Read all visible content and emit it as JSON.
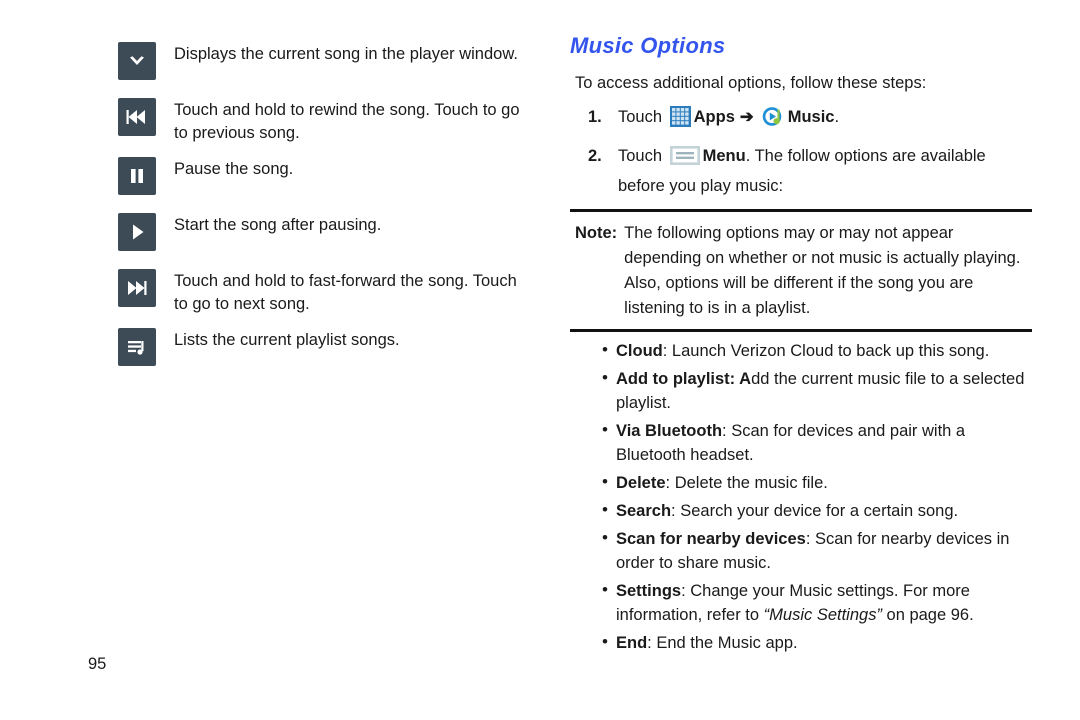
{
  "page_number": "95",
  "left_column": {
    "items": [
      {
        "icon": "chevron-down-icon",
        "text": "Displays the current song in the player window."
      },
      {
        "icon": "rewind-icon",
        "text": "Touch and hold to rewind the song. Touch to go to previous song."
      },
      {
        "icon": "pause-icon",
        "text": "Pause the song."
      },
      {
        "icon": "play-icon",
        "text": "Start the song after pausing."
      },
      {
        "icon": "fast-forward-icon",
        "text": "Touch and hold to fast-forward the song. Touch to go to next song."
      },
      {
        "icon": "playlist-icon",
        "text": "Lists the current playlist songs."
      }
    ]
  },
  "right_column": {
    "heading": "Music Options",
    "heading_color": "#3355ee",
    "intro": "To access additional options, follow these steps:",
    "steps": [
      {
        "number": "1.",
        "pre_icon_text": "Touch ",
        "icon1": "apps-grid-icon",
        "label1": "Apps",
        "arrow": "➔",
        "icon2": "music-app-icon",
        "label2": "Music",
        "post_text": "."
      },
      {
        "number": "2.",
        "pre_icon_text": "Touch ",
        "icon1": "menu-icon",
        "label1": "Menu",
        "post_text": ". The follow options are available before you play music:"
      }
    ],
    "note": {
      "label": "Note:",
      "body": "The following options may or may not appear depending on whether or not music is actually playing. Also, options will be different if the song you are listening to is in a playlist."
    },
    "options": [
      {
        "term": "Cloud",
        "separator": ": ",
        "desc": "Launch Verizon Cloud to back up this song."
      },
      {
        "term": "Add to playlist: A",
        "separator": "",
        "desc": "dd the current music file to a selected playlist."
      },
      {
        "term": "Via Bluetooth",
        "separator": ": ",
        "desc": "Scan for devices and pair with a Bluetooth headset."
      },
      {
        "term": "Delete",
        "separator": ": ",
        "desc": "Delete the music file."
      },
      {
        "term": "Search",
        "separator": ": ",
        "desc": "Search your device for a certain song."
      },
      {
        "term": "Scan for nearby devices",
        "separator": ": ",
        "desc": "Scan for nearby devices in order to share music."
      },
      {
        "term": "Settings",
        "separator": ": ",
        "desc_pre": "Change your Music settings. For more information, refer to ",
        "desc_italic": "“Music Settings”",
        "desc_post": " on page 96."
      },
      {
        "term": "End",
        "separator": ": ",
        "desc": "End the Music app."
      }
    ]
  }
}
